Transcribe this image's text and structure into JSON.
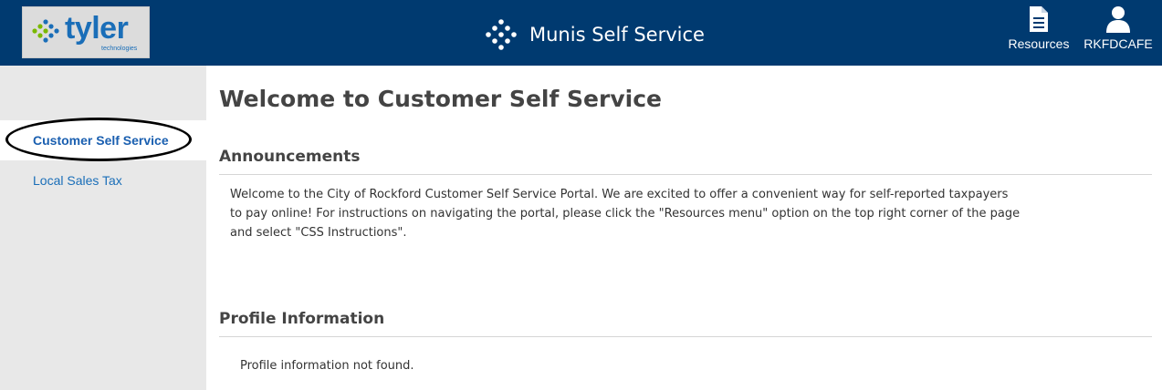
{
  "header": {
    "logo_text": "tyler",
    "logo_subtext": "technologies",
    "app_title": "Munis Self Service",
    "nav": [
      {
        "label": "Resources",
        "icon": "document-icon"
      },
      {
        "label": "RKFDCAFE",
        "icon": "user-icon"
      }
    ],
    "colors": {
      "bar": "#003a70",
      "logo_blue": "#1a6eb8",
      "logo_green": "#7ab800"
    }
  },
  "sidebar": {
    "items": [
      {
        "label": "Customer Self Service",
        "active": true
      },
      {
        "label": "Local Sales Tax",
        "active": false
      }
    ]
  },
  "main": {
    "title": "Welcome to Customer Self Service",
    "announcements": {
      "heading": "Announcements",
      "lines": [
        "Welcome to the City of Rockford Customer Self Service Portal. We are excited to offer a convenient way for self-reported taxpayers",
        "to pay online! For instructions on navigating the portal, please click the \"Resources menu\" option on the top right corner of the page",
        "and select \"CSS Instructions\"."
      ]
    },
    "profile": {
      "heading": "Profile Information",
      "message": "Profile information not found."
    }
  }
}
